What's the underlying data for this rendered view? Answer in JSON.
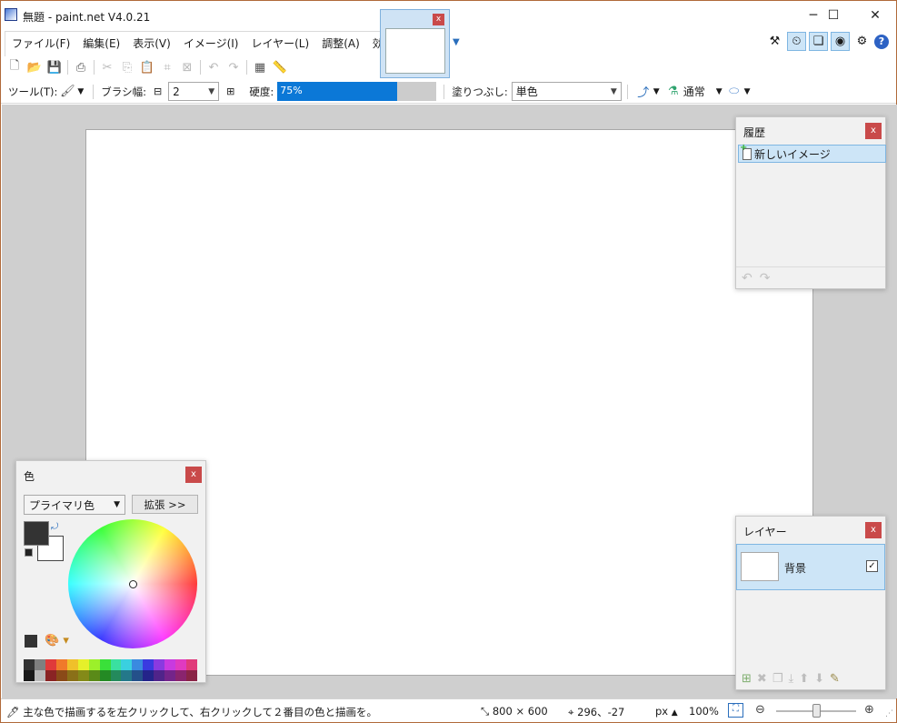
{
  "window": {
    "title": "無題 - paint.net V4.0.21",
    "minimize": "─",
    "maximize": "☐",
    "close": "✕"
  },
  "menu": [
    {
      "label": "ファイル(F)"
    },
    {
      "label": "編集(E)"
    },
    {
      "label": "表示(V)"
    },
    {
      "label": "イメージ(I)"
    },
    {
      "label": "レイヤー(L)"
    },
    {
      "label": "調整(A)"
    },
    {
      "label": "効果(C)"
    }
  ],
  "tab": {
    "close": "x",
    "dropdown": "▼"
  },
  "toolbar2": {
    "tool_label": "ツール(T):",
    "brush_width_label": "ブラシ幅:",
    "brush_width_value": "2",
    "hardness_label": "硬度:",
    "hardness_text": "75%",
    "hardness_percent": 75,
    "fill_label": "塗りつぶし:",
    "fill_value": "単色",
    "blend_value": "通常"
  },
  "history_panel": {
    "title": "履歴",
    "close": "x",
    "items": [
      {
        "label": "新しいイメージ"
      }
    ]
  },
  "layers_panel": {
    "title": "レイヤー",
    "close": "x",
    "layers": [
      {
        "name": "背景",
        "visible": true
      }
    ]
  },
  "colors_panel": {
    "title": "色",
    "close": "x",
    "mode_value": "プライマリ色",
    "expand_label": "拡張 >>",
    "primary_color": "#333333",
    "secondary_color": "#ffffff",
    "palette": [
      "#333333",
      "#7f7f7f",
      "#e03a3a",
      "#f07a2a",
      "#f0c02a",
      "#e6f02a",
      "#9cf02a",
      "#3ae03a",
      "#3ae0a0",
      "#3ad0e0",
      "#3a8ae0",
      "#3a3ae0",
      "#8a3ae0",
      "#c83ae0",
      "#e03ac0",
      "#e03a7a",
      "#1a1a1a",
      "#b9b9b9",
      "#8a2424",
      "#8a4a18",
      "#8a7018",
      "#848a18",
      "#5a8a18",
      "#248a24",
      "#248a5c",
      "#24788a",
      "#24508a",
      "#24248a",
      "#50248a",
      "#74248a",
      "#8a246e",
      "#8a2446"
    ]
  },
  "statusbar": {
    "hint": "主な色で描画するを左クリックして、右クリックして２番目の色と描画を。",
    "image_size": "800 × 600",
    "cursor_pos": "296、-27",
    "unit": "px",
    "zoom": "100%"
  },
  "colors": {
    "accent": "#0b78d7",
    "selection": "#cde5f7",
    "close_red": "#c94a4a"
  }
}
